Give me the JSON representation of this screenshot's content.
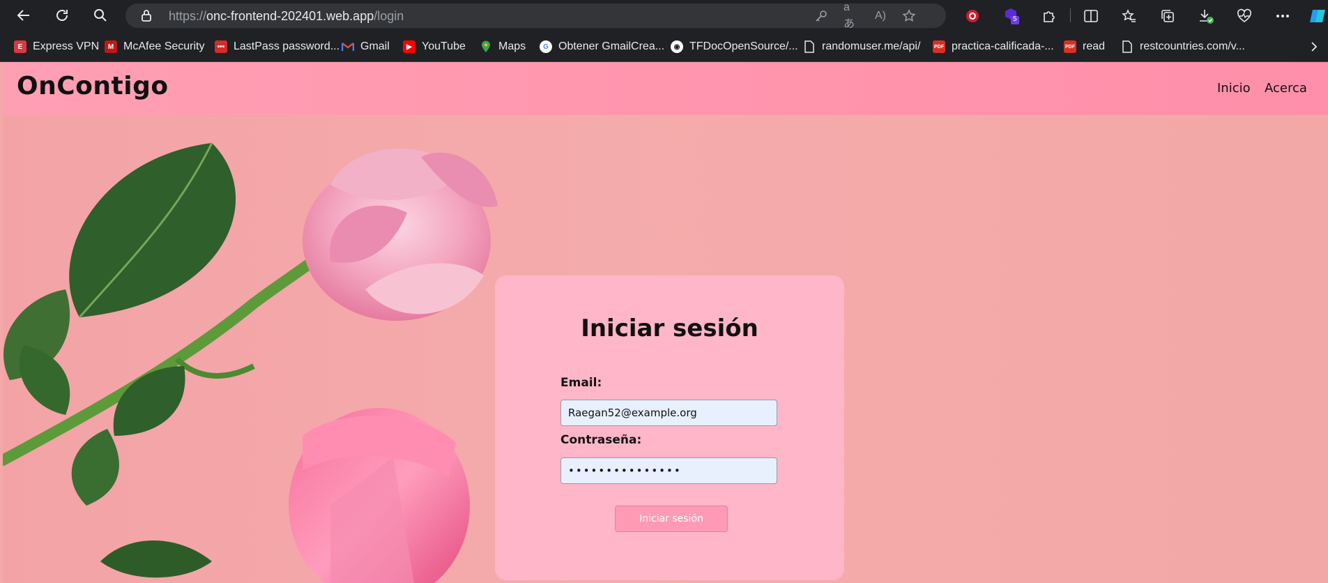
{
  "browser": {
    "url_scheme": "https://",
    "url_host": "onc-frontend-202401.web.app",
    "url_path": "/login",
    "extension_badge": "5"
  },
  "bookmarks": [
    {
      "label": "Express VPN",
      "icon": "expressvpn-icon",
      "color": "#da3940"
    },
    {
      "label": "McAfee Security",
      "icon": "mcafee-icon",
      "color": "#c01818"
    },
    {
      "label": "LastPass password...",
      "icon": "lastpass-icon",
      "color": "#d32d27"
    },
    {
      "label": "Gmail",
      "icon": "gmail-icon",
      "color": "#ea4335"
    },
    {
      "label": "YouTube",
      "icon": "youtube-icon",
      "color": "#ff0000"
    },
    {
      "label": "Maps",
      "icon": "maps-icon",
      "color": "#34a853"
    },
    {
      "label": "Obtener GmailCrea...",
      "icon": "google-icon",
      "color": "#ffffff"
    },
    {
      "label": "TFDocOpenSource/...",
      "icon": "github-icon",
      "color": "#ffffff"
    },
    {
      "label": "randomuser.me/api/",
      "icon": "page-icon",
      "color": "#e8eaed"
    },
    {
      "label": "practica-calificada-...",
      "icon": "pdf-icon",
      "color": "#d93025"
    },
    {
      "label": "read",
      "icon": "pdf-icon",
      "color": "#d93025"
    },
    {
      "label": "restcountries.com/v...",
      "icon": "page-icon",
      "color": "#e8eaed"
    }
  ],
  "site": {
    "brand": "OnContigo",
    "nav": [
      "Inicio",
      "Acerca"
    ]
  },
  "login": {
    "title": "Iniciar sesión",
    "email_label": "Email:",
    "email_value": "Raegan52@example.org",
    "password_label": "Contraseña:",
    "password_value": "•••••••••••••••",
    "submit_label": "Iniciar sesión"
  },
  "colors": {
    "nav_bg": "#ff96ad",
    "card_bg": "#ffb6c9",
    "button_bg": "#ff9ab4",
    "page_bg": "#f4a9a9"
  }
}
